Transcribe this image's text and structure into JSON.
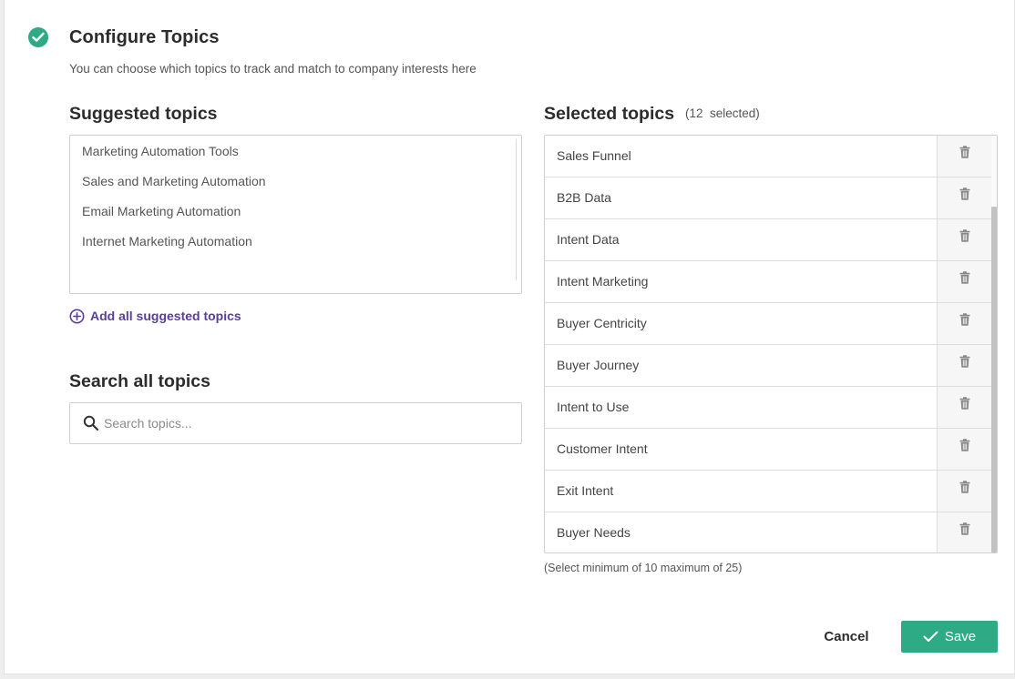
{
  "header": {
    "title": "Configure Topics",
    "subtitle": "You can choose which topics to track and match to company interests here"
  },
  "suggested": {
    "heading": "Suggested topics",
    "items": [
      "Marketing Automation Tools",
      "Sales and Marketing Automation",
      "Email Marketing Automation",
      "Internet Marketing Automation"
    ],
    "add_all_label": "Add all suggested topics"
  },
  "search": {
    "heading": "Search all topics",
    "placeholder": "Search topics...",
    "value": ""
  },
  "selected": {
    "heading": "Selected topics",
    "count_label": "(12  selected)",
    "items": [
      "Sales Funnel",
      "B2B Data",
      "Intent Data",
      "Intent Marketing",
      "Buyer Centricity",
      "Buyer Journey",
      "Intent to Use",
      "Customer Intent",
      "Exit Intent",
      "Buyer Needs"
    ],
    "limit_note": "(Select minimum of 10 maximum of 25)"
  },
  "footer": {
    "cancel_label": "Cancel",
    "save_label": "Save"
  },
  "colors": {
    "accent_green": "#2eaa84",
    "link_purple": "#5a3e9a"
  },
  "icons": {
    "status": "check-icon",
    "add_all": "plus-circle-icon",
    "search": "search-icon",
    "delete": "trash-icon",
    "save": "check-icon"
  }
}
